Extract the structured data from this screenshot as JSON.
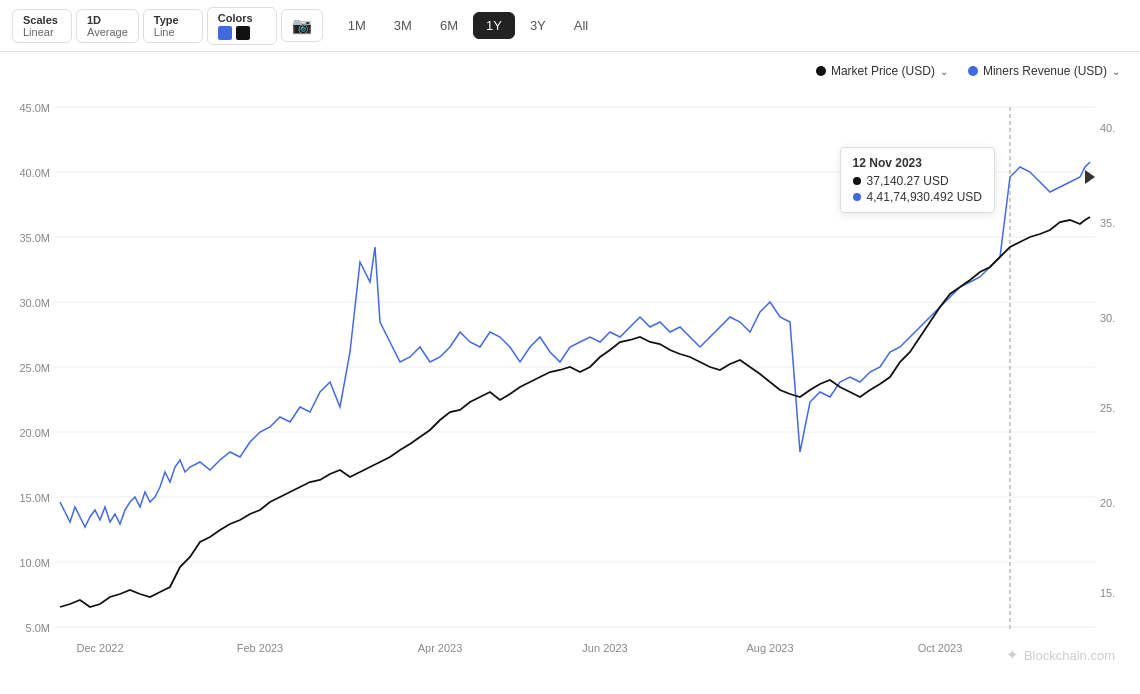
{
  "toolbar": {
    "scales_label": "Scales",
    "scales_value": "Linear",
    "period_label": "1D",
    "period_value": "Average",
    "type_label": "Type",
    "type_value": "Line",
    "colors_label": "Colors",
    "camera_icon": "📷",
    "time_buttons": [
      "1M",
      "3M",
      "6M",
      "1Y",
      "3Y",
      "All"
    ],
    "active_time": "1Y"
  },
  "legend": {
    "market_price": "Market Price (USD)",
    "miners_revenue": "Miners Revenue (USD)"
  },
  "tooltip": {
    "date": "12 Nov 2023",
    "market_price": "37,140.27 USD",
    "miners_revenue": "4,41,74,930.492 USD"
  },
  "y_axis_left": [
    "45.0M",
    "40.0M",
    "35.0M",
    "30.0M",
    "25.0M",
    "20.0M",
    "15.0M",
    "10.0M",
    "5.0M"
  ],
  "y_axis_right": [
    "40.",
    "35.",
    "30.",
    "25.",
    "20.",
    "15."
  ],
  "x_axis": [
    "Dec 2022",
    "Feb 2023",
    "Apr 2023",
    "Jun 2023",
    "Aug 2023",
    "Oct 2023"
  ],
  "colors": {
    "blue": "#4169e1",
    "black": "#111111",
    "market_dot": "#111",
    "miners_dot": "#4169e1"
  },
  "watermark": "Blockchain.com"
}
